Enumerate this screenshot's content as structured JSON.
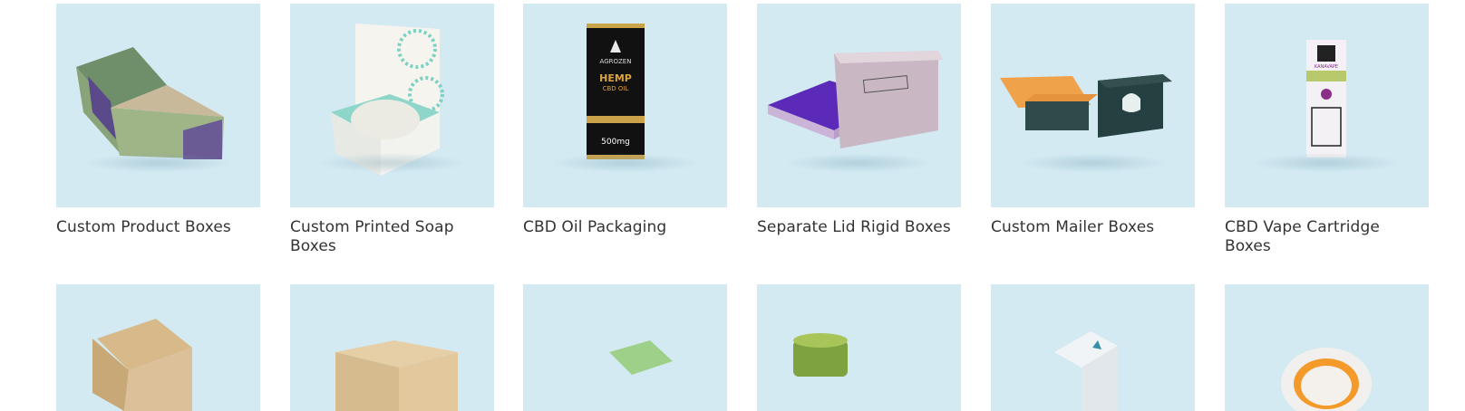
{
  "products": [
    {
      "title": "Custom Product Boxes"
    },
    {
      "title": "Custom Printed Soap Boxes"
    },
    {
      "title": "CBD Oil Packaging",
      "box_text": {
        "brand": "AGROZEN",
        "product": "HEMP",
        "sub": "CBD OIL",
        "strength": "500mg"
      }
    },
    {
      "title": "Separate Lid Rigid Boxes"
    },
    {
      "title": "Custom Mailer Boxes"
    },
    {
      "title": "CBD Vape Cartridge Boxes",
      "box_text": {
        "brand": "KANAVAPE"
      }
    },
    {
      "title": ""
    },
    {
      "title": ""
    },
    {
      "title": ""
    },
    {
      "title": ""
    },
    {
      "title": ""
    },
    {
      "title": ""
    }
  ],
  "colors": {
    "thumb_bg": "#d3eaf2",
    "title": "#333333"
  }
}
